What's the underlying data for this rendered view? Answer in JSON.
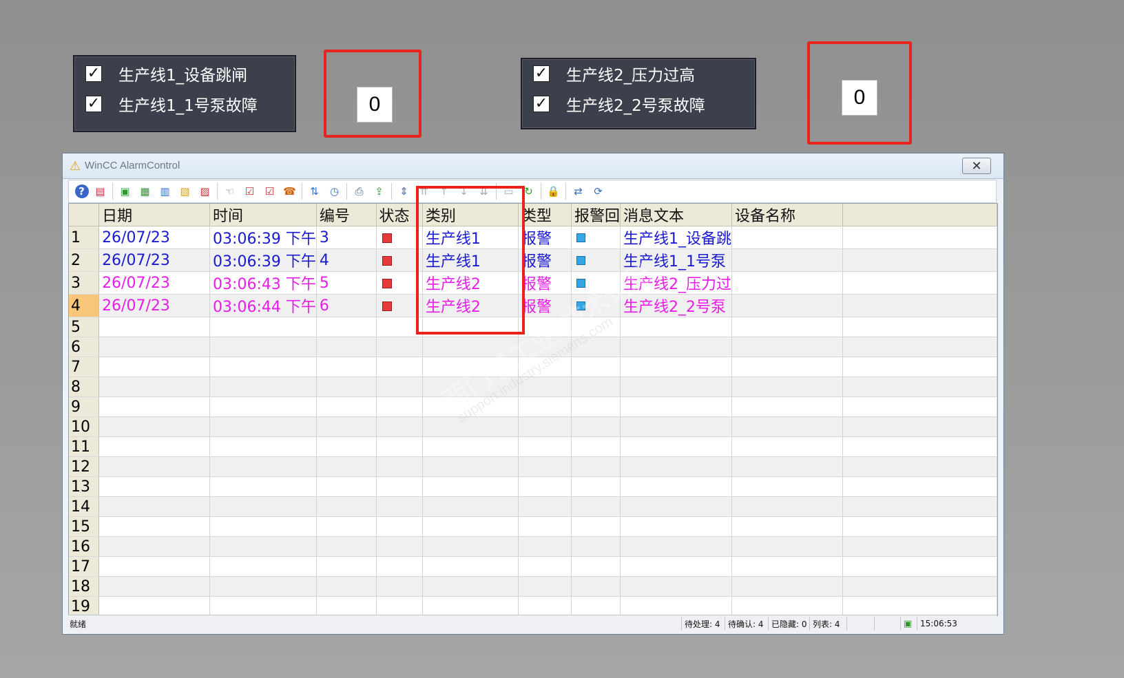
{
  "panels": [
    {
      "items": [
        {
          "checked": "✓",
          "label": "生产线1_设备跳闸"
        },
        {
          "checked": "✓",
          "label": "生产线1_1号泵故障"
        }
      ],
      "value": "0"
    },
    {
      "items": [
        {
          "checked": "✓",
          "label": "生产线2_压力过高"
        },
        {
          "checked": "✓",
          "label": "生产线2_2号泵故障"
        }
      ],
      "value": "0"
    }
  ],
  "window": {
    "title": "WinCC AlarmControl",
    "toolbar_icons": [
      "help-icon",
      "selection-dialog-icon",
      "alarm-list-icon",
      "short-term-archive-icon",
      "long-term-archive-icon",
      "lock-list-icon",
      "hit-list-icon",
      "loop-in-alarm-icon",
      "single-ack-icon",
      "group-ack-icon",
      "emergency-ack-icon",
      "sort-icon",
      "time-base-icon",
      "print-icon",
      "export-icon",
      "autoscroll-icon",
      "first-message-icon",
      "previous-message-icon",
      "next-message-icon",
      "last-message-icon",
      "info-text-icon",
      "comment-icon",
      "lock-icon",
      "column-config-icon",
      "refresh-icon"
    ],
    "columns": [
      "",
      "日期",
      "时间",
      "编号",
      "状态",
      "类别",
      "类型",
      "报警回",
      "消息文本",
      "设备名称"
    ],
    "rows": [
      {
        "num": "1",
        "date": "26/07/23",
        "time": "03:06:39 下午",
        "id": "3",
        "category": "生产线1",
        "type": "报警",
        "text": "生产线1_设备跳",
        "color": "#1a1ad0"
      },
      {
        "num": "2",
        "date": "26/07/23",
        "time": "03:06:39 下午",
        "id": "4",
        "category": "生产线1",
        "type": "报警",
        "text": "生产线1_1号泵",
        "color": "#1a1ad0"
      },
      {
        "num": "3",
        "date": "26/07/23",
        "time": "03:06:43 下午",
        "id": "5",
        "category": "生产线2",
        "type": "报警",
        "text": "生产线2_压力过",
        "color": "#e81ce8"
      },
      {
        "num": "4",
        "date": "26/07/23",
        "time": "03:06:44 下午",
        "id": "6",
        "category": "生产线2",
        "type": "报警",
        "text": "生产线2_2号泵",
        "color": "#e81ce8"
      }
    ],
    "empty_rows": [
      "5",
      "6",
      "7",
      "8",
      "9",
      "10",
      "11",
      "12",
      "13",
      "14",
      "15",
      "16",
      "17",
      "18",
      "19"
    ],
    "selected_row": "4",
    "statusbar": {
      "left": "就绪",
      "pending": "待处理: 4",
      "to_ack": "待确认: 4",
      "hidden": "已隐藏: 0",
      "list": "列表: 4",
      "time": "15:06:53"
    }
  },
  "watermark": {
    "line1": "西门子工业 技术论坛",
    "line2": "support.industry.siemens.com"
  }
}
